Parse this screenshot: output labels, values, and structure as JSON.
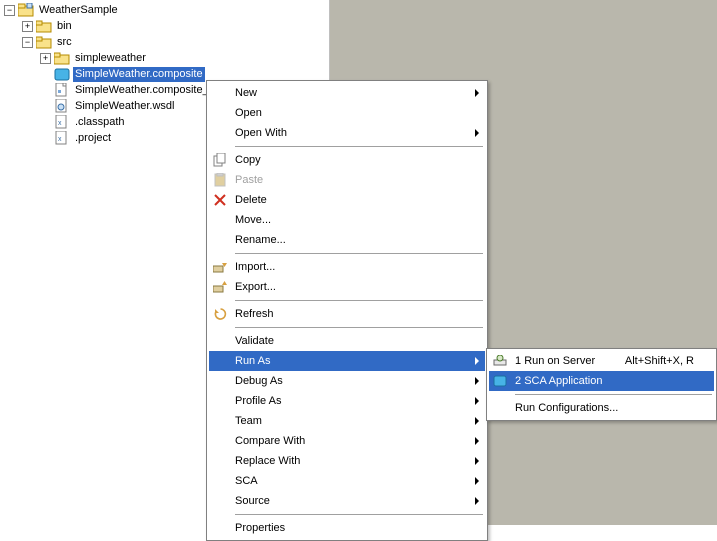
{
  "tree": {
    "root": "WeatherSample",
    "bin": "bin",
    "src": "src",
    "pkg": "simpleweather",
    "file_selected": "SimpleWeather.composite",
    "file_diagram": "SimpleWeather.composite_",
    "file_wsdl": "SimpleWeather.wsdl",
    "classpath": ".classpath",
    "project": ".project"
  },
  "menu": {
    "new": "New",
    "open": "Open",
    "open_with": "Open With",
    "copy": "Copy",
    "paste": "Paste",
    "delete": "Delete",
    "move": "Move...",
    "rename": "Rename...",
    "import": "Import...",
    "export": "Export...",
    "refresh": "Refresh",
    "validate": "Validate",
    "run_as": "Run As",
    "debug_as": "Debug As",
    "profile_as": "Profile As",
    "team": "Team",
    "compare_with": "Compare With",
    "replace_with": "Replace With",
    "sca": "SCA",
    "source": "Source",
    "properties": "Properties"
  },
  "submenu": {
    "run_server": {
      "num": "1",
      "label": "Run on Server",
      "accel": "Alt+Shift+X, R"
    },
    "sca_app": {
      "num": "2",
      "label": "SCA Application"
    },
    "run_conf": {
      "label": "Run Configurations..."
    }
  }
}
